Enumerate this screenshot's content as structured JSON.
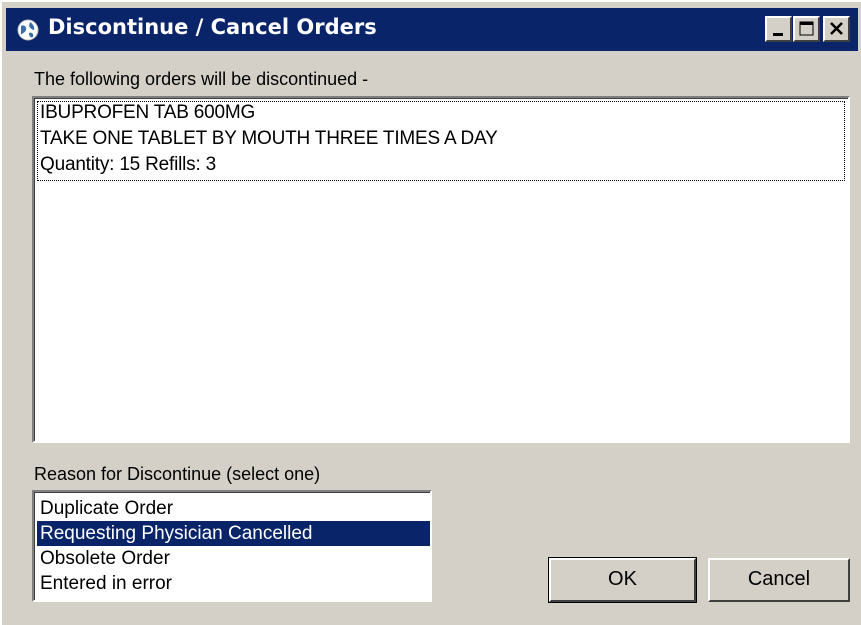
{
  "window": {
    "title": "Discontinue / Cancel Orders",
    "icon": "globe-icon"
  },
  "titlebar_buttons": [
    "minimize-icon",
    "maximize-icon",
    "close-icon"
  ],
  "orders": {
    "label": "The following orders will be discontinued -",
    "items": [
      {
        "lines": [
          "IBUPROFEN TAB  600MG",
          "TAKE ONE TABLET BY MOUTH THREE TIMES A DAY",
          "Quantity: 15 Refills: 3"
        ]
      }
    ]
  },
  "reason": {
    "label": "Reason for Discontinue (select one)",
    "options": [
      "Duplicate Order",
      "Requesting Physician Cancelled",
      "Obsolete Order",
      "Entered in error"
    ],
    "selected": "Requesting Physician Cancelled"
  },
  "buttons": {
    "ok": "OK",
    "cancel": "Cancel"
  },
  "colors": {
    "titlebar": "#0a246a",
    "face": "#d4d0c8",
    "selection": "#0a246a"
  }
}
